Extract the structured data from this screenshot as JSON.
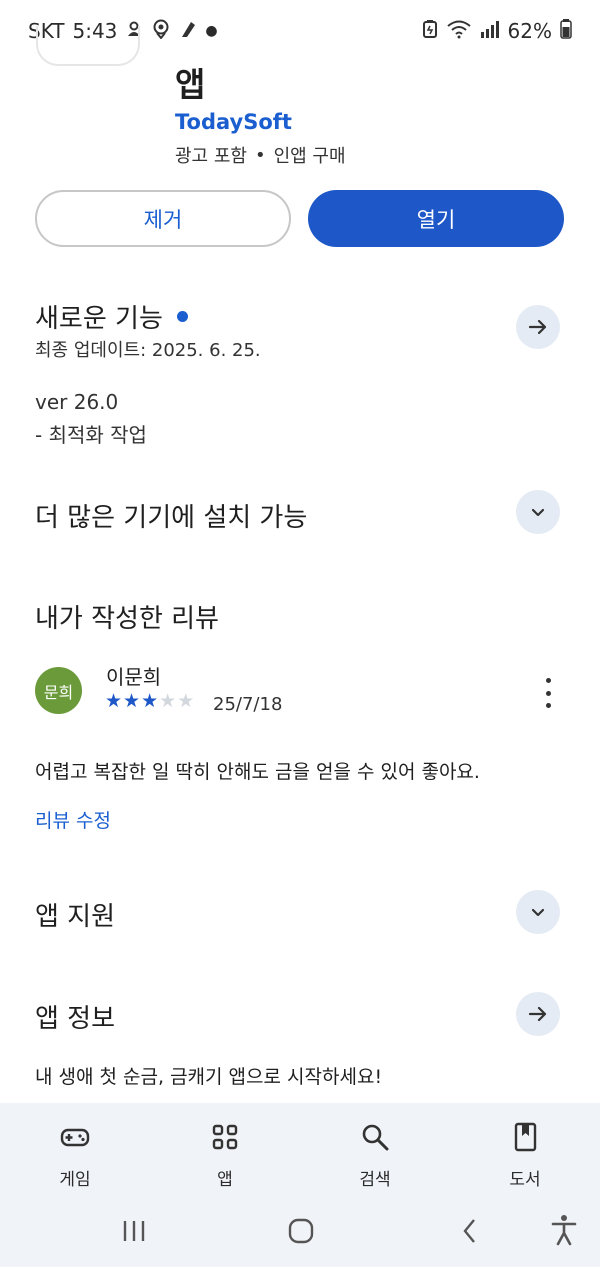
{
  "status_bar": {
    "carrier": "SKT",
    "time": "5:43",
    "battery": "62%",
    "left_icons": [
      "notification-icon",
      "location-icon",
      "app-icon"
    ],
    "right_icons": [
      "battery-saver-icon",
      "wifi-icon",
      "signal-icon",
      "battery-icon"
    ]
  },
  "app": {
    "title": "앱",
    "developer": "TodaySoft",
    "meta_ads": "광고 포함",
    "meta_separator": "•",
    "meta_iap": "인앱 구매"
  },
  "actions": {
    "remove_label": "제거",
    "open_label": "열기"
  },
  "whats_new": {
    "title": "새로운 기능",
    "updated": "최종 업데이트: 2025. 6. 25.",
    "version": "ver 26.0",
    "note": "- 최적화 작업"
  },
  "more_devices": {
    "title": "더 많은 기기에 설치 가능"
  },
  "my_review": {
    "title": "내가 작성한 리뷰",
    "avatar_text": "문희",
    "reviewer": "이문희",
    "rating": 3,
    "max_rating": 5,
    "date": "25/7/18",
    "text": "어렵고 복잡한 일 딱히 안해도 금을 얻을 수 있어 좋아요.",
    "edit_label": "리뷰 수정"
  },
  "app_support": {
    "title": "앱 지원"
  },
  "app_info": {
    "title": "앱 정보",
    "description": "내 생애 첫 순금, 금캐기 앱으로 시작하세요!"
  },
  "bottom_nav": {
    "tabs": [
      {
        "label": "게임",
        "icon": "gamepad-icon"
      },
      {
        "label": "앱",
        "icon": "apps-grid-icon"
      },
      {
        "label": "검색",
        "icon": "search-icon"
      },
      {
        "label": "도서",
        "icon": "book-icon"
      }
    ]
  },
  "colors": {
    "accent": "#1e57c8",
    "link": "#1a5ed0",
    "round_button_bg": "#e4ebf4",
    "avatar_bg": "#6a9a3a",
    "nav_bg": "#f0f3f8"
  }
}
